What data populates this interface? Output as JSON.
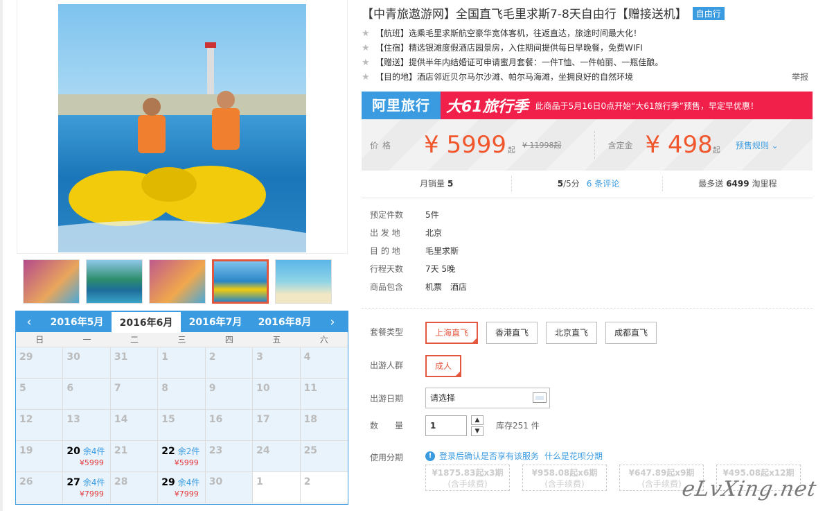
{
  "title": "【中青旅遨游网】全国直飞毛里求斯7-8天自由行【赠接送机】",
  "title_tag": "自由行",
  "features": [
    "【航班】选乘毛里求斯航空豪华宽体客机，往返直达，旅途时间最大化！",
    "【住宿】精选银滩度假酒店园景房，入住期间提供每日早晚餐，免费WIFI",
    "【赠送】提供半年内结婚证可申请蜜月套餐：一件T恤、一件帕丽、一瓶佳酿。",
    "【目的地】酒店邻近贝尔马尔沙滩、帕尔马海滩，坐拥良好的自然环境"
  ],
  "report": "举报",
  "banner": {
    "brand": "阿里旅行",
    "campaign": "大61旅行季",
    "text": "此商品于5月16日0点开始“大61旅行季”预售，早定早优惠！"
  },
  "price": {
    "label": "价格",
    "value": "¥ 5999",
    "suffix": "起",
    "original": "¥ 11998起",
    "deposit_label": "含定金",
    "deposit": "¥ 498",
    "deposit_suffix": "起",
    "rule": "预售规则 ⌄"
  },
  "stats": {
    "monthly_label": "月销量",
    "monthly": "5",
    "score": "5",
    "score_suffix": "/5分",
    "reviews": "6 条评论",
    "points_prefix": "最多送",
    "points": "6499",
    "points_suffix": "淘里程"
  },
  "info": [
    {
      "k": "预定件数",
      "v": "5件"
    },
    {
      "k": "出 发 地",
      "v": "北京"
    },
    {
      "k": "目 的 地",
      "v": "毛里求斯"
    },
    {
      "k": "行程天数",
      "v": "7天 5晚"
    },
    {
      "k": "商品包含",
      "v": "机票　酒店"
    }
  ],
  "options": {
    "package_label": "套餐类型",
    "packages": [
      "上海直飞",
      "香港直飞",
      "北京直飞",
      "成都直飞"
    ],
    "traveler_label": "出游人群",
    "traveler": "成人",
    "date_label": "出游日期",
    "date_value": "请选择",
    "qty_label": "数　　量",
    "qty_value": "1",
    "stock": "库存251 件",
    "installment_label": "使用分期",
    "installment_note": "登录后确认是否享有该服务",
    "installment_link": "什么是花呗分期"
  },
  "terms": [
    {
      "line1": "¥1875.83起x3期",
      "line2": "(含手续费)"
    },
    {
      "line1": "¥958.08起x6期",
      "line2": "(含手续费)"
    },
    {
      "line1": "¥647.89起x9期",
      "line2": "(含手续费)"
    },
    {
      "line1": "¥495.08起x12期",
      "line2": ""
    }
  ],
  "calendar": {
    "months": [
      "2016年5月",
      "2016年6月",
      "2016年7月",
      "2016年8月"
    ],
    "active_month": 1,
    "weekdays": [
      "日",
      "一",
      "二",
      "三",
      "四",
      "五",
      "六"
    ],
    "cells": [
      {
        "d": "29"
      },
      {
        "d": "30"
      },
      {
        "d": "31"
      },
      {
        "d": "1"
      },
      {
        "d": "2"
      },
      {
        "d": "3"
      },
      {
        "d": "4"
      },
      {
        "d": "5"
      },
      {
        "d": "6"
      },
      {
        "d": "7"
      },
      {
        "d": "8"
      },
      {
        "d": "9"
      },
      {
        "d": "10"
      },
      {
        "d": "11"
      },
      {
        "d": "12"
      },
      {
        "d": "13"
      },
      {
        "d": "14"
      },
      {
        "d": "15"
      },
      {
        "d": "16"
      },
      {
        "d": "17"
      },
      {
        "d": "18"
      },
      {
        "d": "19"
      },
      {
        "d": "20",
        "rem": "余4件",
        "price": "¥5999"
      },
      {
        "d": "21"
      },
      {
        "d": "22",
        "rem": "余2件",
        "price": "¥5999"
      },
      {
        "d": "23"
      },
      {
        "d": "24"
      },
      {
        "d": "25"
      },
      {
        "d": "26"
      },
      {
        "d": "27",
        "rem": "余4件",
        "price": "¥7999"
      },
      {
        "d": "28"
      },
      {
        "d": "29",
        "rem": "余4件",
        "price": "¥7999"
      },
      {
        "d": "30"
      },
      {
        "d": "1",
        "white": true
      },
      {
        "d": "2",
        "white": true
      }
    ]
  },
  "watermark": "eLvXing.net",
  "colors": {
    "accent": "#3a9be0",
    "price": "#f1572d",
    "selected": "#e4573f",
    "banner_red": "#f0204a"
  }
}
